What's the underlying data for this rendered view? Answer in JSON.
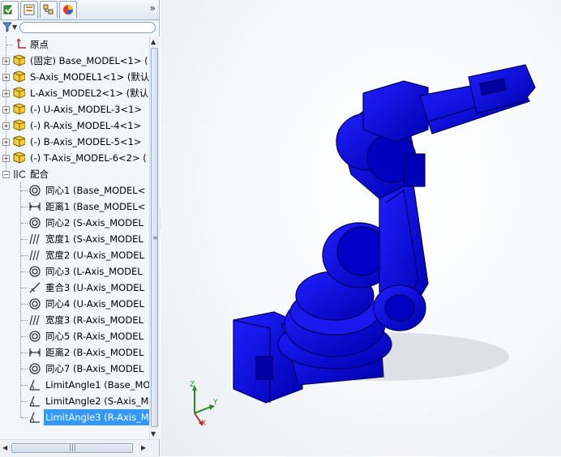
{
  "tabs": [
    {
      "name": "feature-manager-tab",
      "icon": "feature-tree-icon"
    },
    {
      "name": "property-manager-tab",
      "icon": "property-icon"
    },
    {
      "name": "configuration-manager-tab",
      "icon": "configuration-icon"
    },
    {
      "name": "display-manager-tab",
      "icon": "appearance-icon"
    }
  ],
  "tab_more": "»",
  "tree": {
    "origin": "原点",
    "components": [
      "(固定) Base_MODEL<1> (",
      "S-Axis_MODEL1<1> (默认",
      "L-Axis_MODEL2<1> (默认",
      "(-) U-Axis_MODEL-3<1>",
      "(-) R-Axis_MODEL-4<1>",
      "(-) B-Axis_MODEL-5<1>",
      "(-) T-Axis_MODEL-6<2> ("
    ],
    "mates_folder": "配合",
    "mates": [
      {
        "label": "同心1 (Base_MODEL<",
        "icon": "concentric-mate-icon"
      },
      {
        "label": "距离1 (Base_MODEL<",
        "icon": "distance-mate-icon"
      },
      {
        "label": "同心2 (S-Axis_MODEL",
        "icon": "concentric-mate-icon"
      },
      {
        "label": "宽度1 (S-Axis_MODEL",
        "icon": "width-mate-icon"
      },
      {
        "label": "宽度2 (U-Axis_MODEL",
        "icon": "width-mate-icon"
      },
      {
        "label": "同心3 (L-Axis_MODEL",
        "icon": "concentric-mate-icon"
      },
      {
        "label": "重合3 (U-Axis_MODEL",
        "icon": "coincident-mate-icon"
      },
      {
        "label": "同心4 (U-Axis_MODEL",
        "icon": "concentric-mate-icon"
      },
      {
        "label": "宽度3 (R-Axis_MODEL",
        "icon": "width-mate-icon"
      },
      {
        "label": "同心5 (R-Axis_MODEL",
        "icon": "concentric-mate-icon"
      },
      {
        "label": "距离2 (B-Axis_MODEL",
        "icon": "distance-mate-icon"
      },
      {
        "label": "同心7 (B-Axis_MODEL",
        "icon": "concentric-mate-icon"
      },
      {
        "label": "LimitAngle1 (Base_MO",
        "icon": "limit-angle-mate-icon"
      },
      {
        "label": "LimitAngle2 (S-Axis_M",
        "icon": "limit-angle-mate-icon"
      },
      {
        "label": "LimitAngle3 (R-Axis_M",
        "icon": "limit-angle-mate-icon",
        "selected": true
      }
    ]
  },
  "triad": {
    "x": "X",
    "y": "Y",
    "z": "Z"
  },
  "colors": {
    "model_blue": "#0a0ad6",
    "model_dark": "#000080",
    "selection": "#3399ff",
    "part_yellow": "#f2cf3a"
  }
}
